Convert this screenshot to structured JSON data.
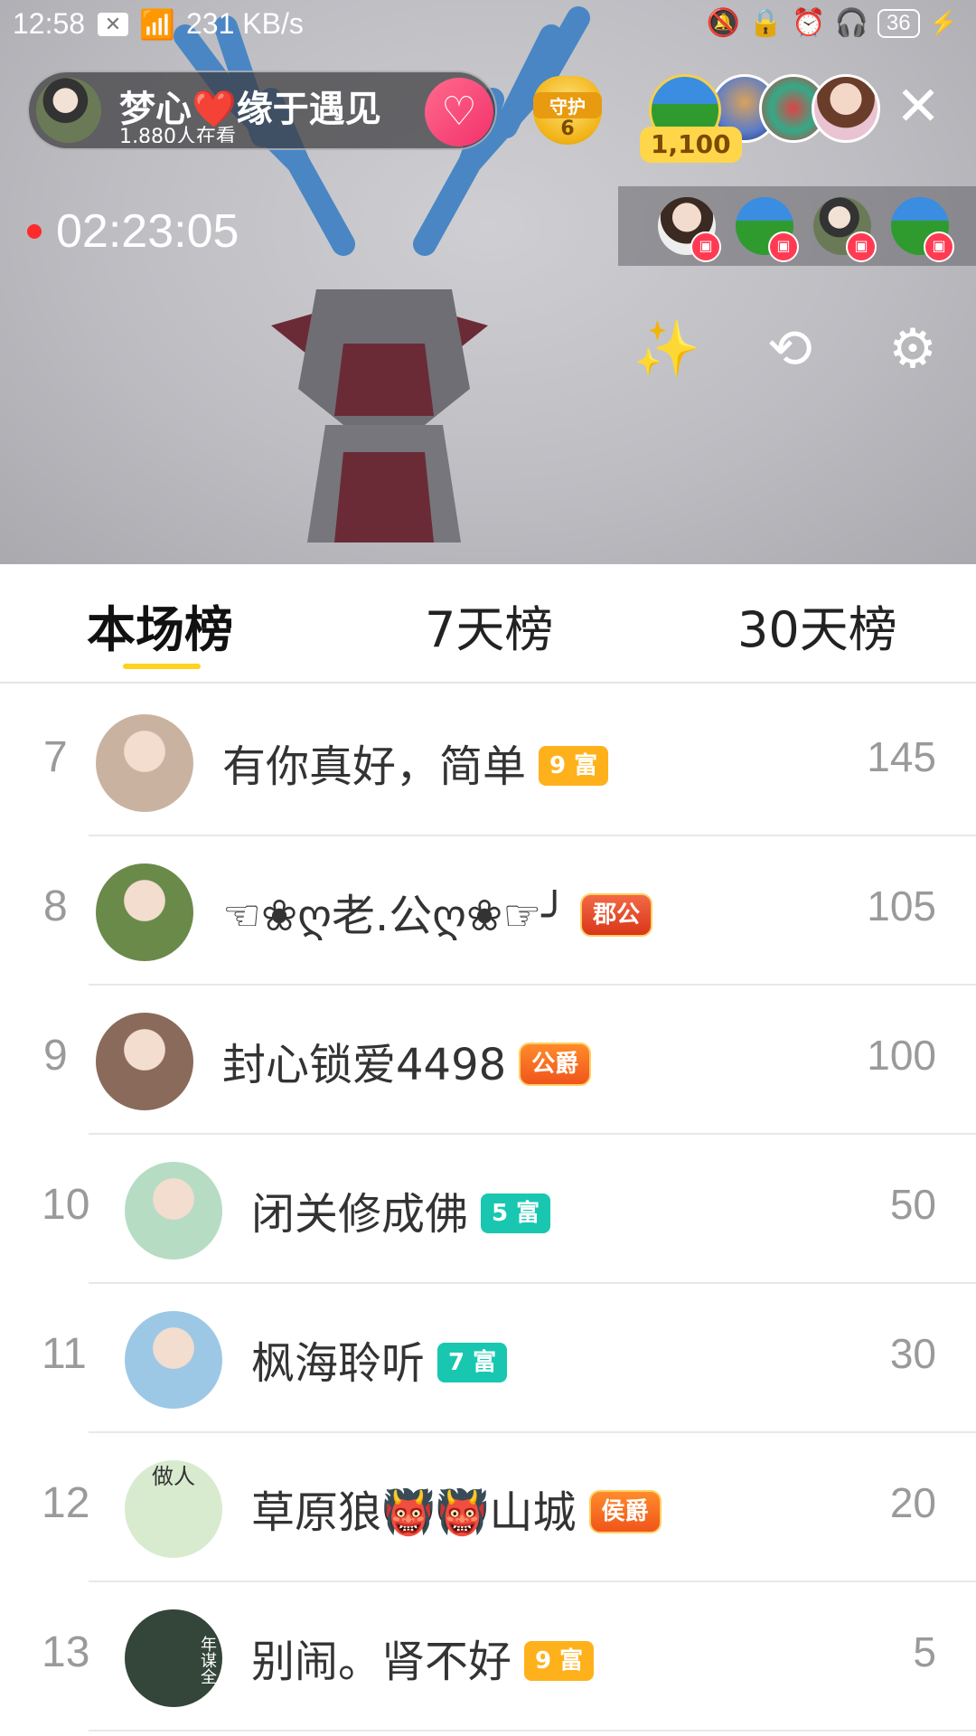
{
  "status_bar": {
    "time": "12:58",
    "notif_icon": "x-box-icon",
    "speed": "231 KB/s",
    "battery": "36"
  },
  "host": {
    "name": "梦心❤️缘于遇见",
    "viewers": "1,880人在看",
    "follow_icon": "heart-plus-icon"
  },
  "guard": {
    "label": "守护",
    "count": "6"
  },
  "top_viewers": {
    "coins": "1,100"
  },
  "timer": "02:23:05",
  "tabs": [
    {
      "label": "本场榜",
      "active": true
    },
    {
      "label": "7天榜",
      "active": false
    },
    {
      "label": "30天榜",
      "active": false
    }
  ],
  "ranking": [
    {
      "rank": "7",
      "name": "有你真好，简单",
      "badge": "9 富",
      "badge_style": "gold",
      "score": "145",
      "avatar_color": "#c9b3a0"
    },
    {
      "rank": "8",
      "name": "☜❀ღ老.公ღ❀☞╯",
      "badge": "郡公",
      "badge_style": "red",
      "score": "105",
      "avatar_color": "#6a8a4a"
    },
    {
      "rank": "9",
      "name": "封心锁爱4498",
      "badge": "公爵",
      "badge_style": "orange",
      "score": "100",
      "avatar_color": "#8a6a5a"
    },
    {
      "rank": "10",
      "name": "闭关修成佛",
      "badge": "5 富",
      "badge_style": "teal",
      "score": "50",
      "avatar_color": "#b7dcc4"
    },
    {
      "rank": "11",
      "name": "枫海聆听",
      "badge": "7 富",
      "badge_style": "teal",
      "score": "30",
      "avatar_color": "#9cc8e6"
    },
    {
      "rank": "12",
      "name": "草原狼👹👹山城",
      "badge": "侯爵",
      "badge_style": "orange",
      "score": "20",
      "avatar_color": "#cfe3c2"
    },
    {
      "rank": "13",
      "name": "别闹。肾不好",
      "badge": "9 富",
      "badge_style": "gold",
      "score": "5",
      "avatar_color": "#3a4a3c"
    }
  ],
  "avatar_text": {
    "row12": "做人",
    "row13": "年谋全"
  }
}
